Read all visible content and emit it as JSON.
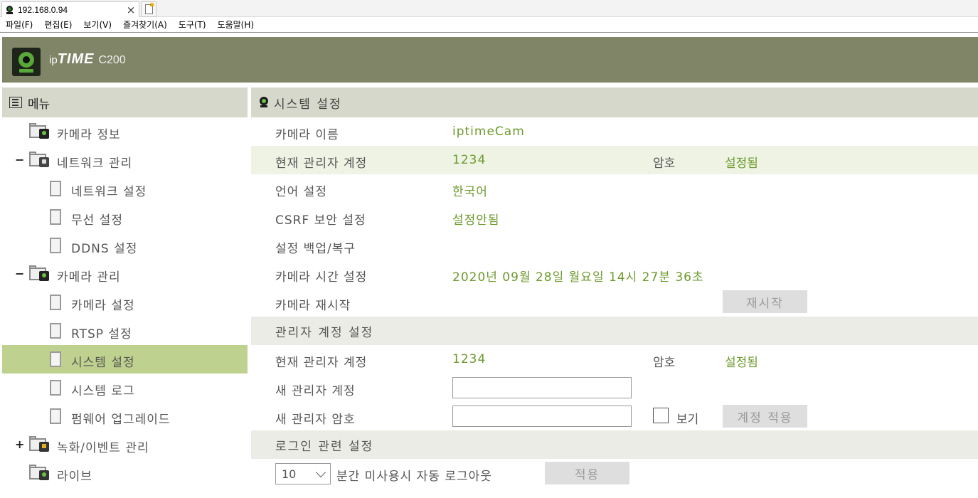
{
  "browser": {
    "tab_title": "192.168.0.94",
    "tab_close": "×",
    "menu": [
      "파일(F)",
      "편집(E)",
      "보기(V)",
      "즐겨찾기(A)",
      "도구(T)",
      "도움말(H)"
    ]
  },
  "header": {
    "brand_ip": "ip",
    "brand_time": "TIME",
    "model": "C200",
    "bar_color": "#7f8566"
  },
  "sidebar": {
    "title": "메뉴",
    "items": [
      {
        "label": "카메라 정보",
        "toggle": ""
      },
      {
        "label": "네트워크 관리",
        "toggle": "−"
      },
      {
        "label": "네트워크 설정"
      },
      {
        "label": "무선 설정"
      },
      {
        "label": "DDNS 설정"
      },
      {
        "label": "카메라 관리",
        "toggle": "−"
      },
      {
        "label": "카메라 설정"
      },
      {
        "label": "RTSP 설정"
      },
      {
        "label": "시스템 설정"
      },
      {
        "label": "시스템 로그"
      },
      {
        "label": "펌웨어 업그레이드"
      },
      {
        "label": "녹화/이벤트 관리",
        "toggle": "+"
      },
      {
        "label": "라이브",
        "toggle": ""
      }
    ],
    "selected_color": "#bfd18e"
  },
  "system": {
    "title": "시스템 설정",
    "camera_name_label": "카메라 이름",
    "camera_name": "iptimeCam",
    "admin_label": "현재 관리자 계정",
    "admin_value": "1234",
    "password_label": "암호",
    "password_value": "설정됨",
    "language_label": "언어 설정",
    "language_value": "한국어",
    "csrf_label": "CSRF 보안 설정",
    "csrf_value": "설정안됨",
    "backup_label": "설정 백업/복구",
    "time_label": "카메라 시간 설정",
    "time_value": "2020년 09월 28일 월요일 14시 27분 36초",
    "restart_label": "카메라 재시작",
    "restart_button": "재시작"
  },
  "admin": {
    "title": "관리자 계정 설정",
    "current_label": "현재 관리자 계정",
    "current_value": "1234",
    "password_label": "암호",
    "password_value": "설정됨",
    "new_account_label": "새 관리자 계정",
    "new_account_value": "",
    "new_password_label": "새 관리자 암호",
    "new_password_value": "",
    "show_label": "보기",
    "apply_button": "계정 적용"
  },
  "login": {
    "title": "로그인 관련 설정",
    "timeout_value": "10",
    "timeout_suffix": "분간 미사용시 자동 로그아웃",
    "apply_button": "적용"
  }
}
